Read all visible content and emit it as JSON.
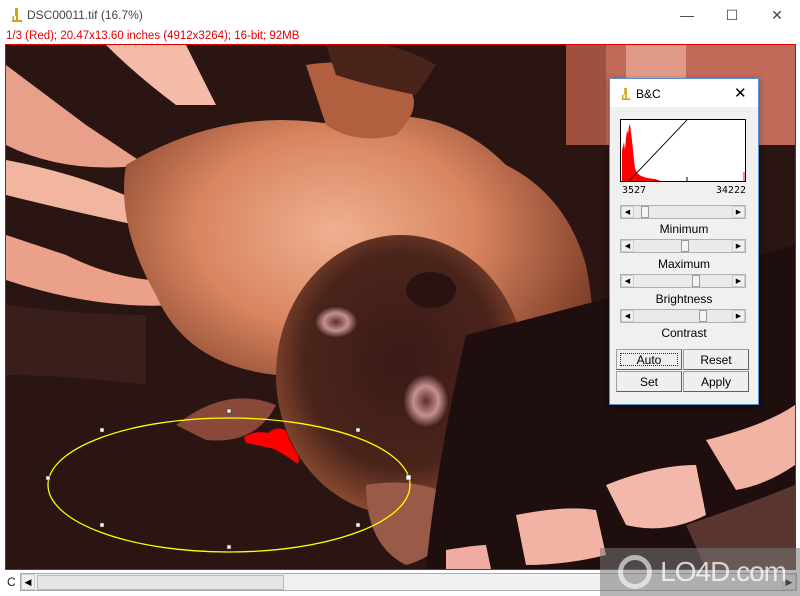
{
  "window": {
    "title": "DSC00011.tif (16.7%)",
    "controls": {
      "minimize": "—",
      "maximize": "☐",
      "close": "✕"
    }
  },
  "image_info": "1/3 (Red); 20.47x13.60 inches (4912x3264); 16-bit; 92MB",
  "colors": {
    "accent_red": "#e00000",
    "roi_yellow": "#ffff00",
    "histogram_fill": "#ff0000",
    "dialog_border": "#5a8fcf"
  },
  "bottom": {
    "channel_label": "C",
    "scroll_left": "◀",
    "scroll_right": "▶"
  },
  "watermark": "LO4D.com",
  "bc_dialog": {
    "title": "B&C",
    "close": "✕",
    "histogram": {
      "display_min": "3527",
      "display_max": "34222"
    },
    "sliders": [
      {
        "label": "Minimum",
        "value_fraction": 0.08
      },
      {
        "label": "Maximum",
        "value_fraction": 0.52
      },
      {
        "label": "Brightness",
        "value_fraction": 0.64
      },
      {
        "label": "Contrast",
        "value_fraction": 0.72
      }
    ],
    "buttons": {
      "auto": "Auto",
      "reset": "Reset",
      "set": "Set",
      "apply": "Apply"
    },
    "arrow_left": "◀",
    "arrow_right": "▶"
  }
}
